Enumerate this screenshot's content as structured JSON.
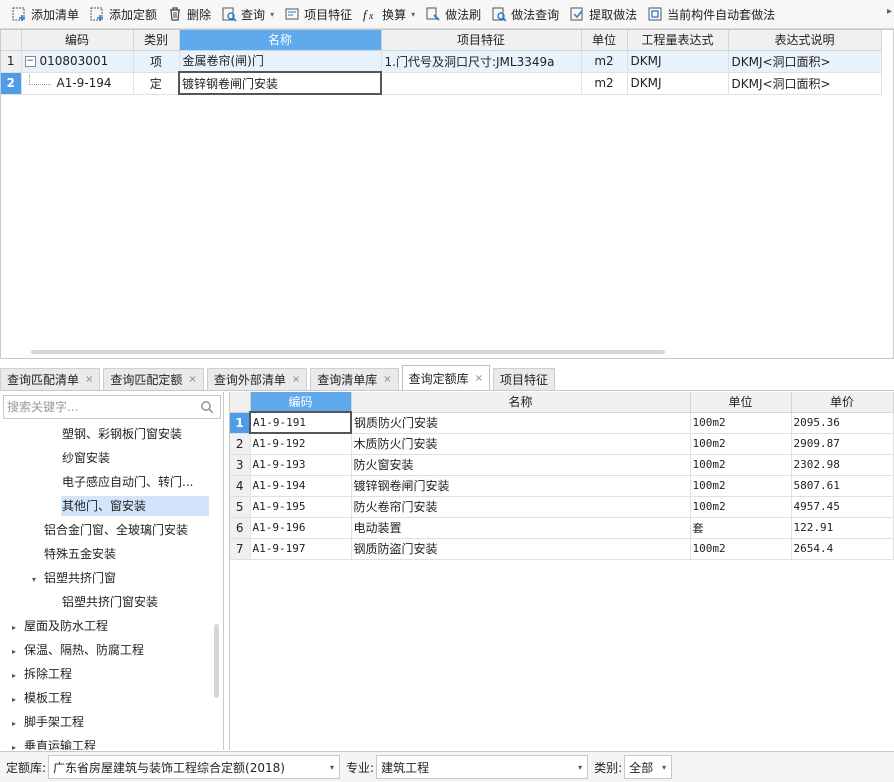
{
  "toolbar": {
    "items": [
      {
        "label": "添加清单",
        "icon": "add-list-icon",
        "dropdown": false
      },
      {
        "label": "添加定额",
        "icon": "add-quota-icon",
        "dropdown": false
      },
      {
        "label": "删除",
        "icon": "trash-icon",
        "dropdown": false
      },
      {
        "label": "查询",
        "icon": "query-icon",
        "dropdown": true
      },
      {
        "label": "项目特征",
        "icon": "feature-icon",
        "dropdown": false
      },
      {
        "label": "换算",
        "icon": "fx-icon",
        "dropdown": true
      },
      {
        "label": "做法刷",
        "icon": "brush-icon",
        "dropdown": false
      },
      {
        "label": "做法查询",
        "icon": "method-query-icon",
        "dropdown": false
      },
      {
        "label": "提取做法",
        "icon": "extract-icon",
        "dropdown": false
      },
      {
        "label": "当前构件自动套做法",
        "icon": "auto-apply-icon",
        "dropdown": false
      }
    ]
  },
  "upper_grid": {
    "headers": [
      "编码",
      "类别",
      "名称",
      "项目特征",
      "单位",
      "工程量表达式",
      "表达式说明"
    ],
    "rows": [
      {
        "row_no": "1",
        "toggle": "−",
        "code": "010803001",
        "type": "项",
        "name": "金属卷帘(闸)门",
        "feature": "1.门代号及洞口尺寸:JML3349a",
        "unit": "m2",
        "expr": "DKMJ",
        "expr_desc": "DKMJ<洞口面积>"
      },
      {
        "row_no": "2",
        "code": "A1-9-194",
        "type": "定",
        "name": "镀锌钢卷闸门安装",
        "feature": "",
        "unit": "m2",
        "expr": "DKMJ",
        "expr_desc": "DKMJ<洞口面积>"
      }
    ]
  },
  "tabs": [
    {
      "label": "查询匹配清单",
      "active": false
    },
    {
      "label": "查询匹配定额",
      "active": false
    },
    {
      "label": "查询外部清单",
      "active": false
    },
    {
      "label": "查询清单库",
      "active": false
    },
    {
      "label": "查询定额库",
      "active": true
    },
    {
      "label": "项目特征",
      "active": false
    }
  ],
  "tab_close": "×",
  "left_panel": {
    "search_placeholder": "搜索关键字...",
    "tree": [
      {
        "label": "塑钢、彩钢板门窗安装",
        "arrow": ""
      },
      {
        "label": "纱窗安装",
        "arrow": ""
      },
      {
        "label": "电子感应自动门、转门...",
        "arrow": ""
      },
      {
        "label": "其他门、窗安装",
        "arrow": ""
      },
      {
        "label": "铝合金门窗、全玻璃门安装",
        "arrow": ""
      },
      {
        "label": "特殊五金安装",
        "arrow": ""
      },
      {
        "label": "铝塑共挤门窗",
        "arrow": "▾"
      },
      {
        "label": "铝塑共挤门窗安装",
        "arrow": ""
      },
      {
        "label": "屋面及防水工程",
        "arrow": "▸"
      },
      {
        "label": "保温、隔热、防腐工程",
        "arrow": "▸"
      },
      {
        "label": "拆除工程",
        "arrow": "▸"
      },
      {
        "label": "模板工程",
        "arrow": "▸"
      },
      {
        "label": "脚手架工程",
        "arrow": "▸"
      },
      {
        "label": "垂直运输工程",
        "arrow": "▸"
      }
    ]
  },
  "lower_grid": {
    "headers": [
      "编码",
      "名称",
      "单位",
      "单价"
    ],
    "rows": [
      {
        "row_no": "1",
        "code": "A1-9-191",
        "name": "钢质防火门安装",
        "unit": "100m2",
        "price": "2095.36"
      },
      {
        "row_no": "2",
        "code": "A1-9-192",
        "name": "木质防火门安装",
        "unit": "100m2",
        "price": "2909.87"
      },
      {
        "row_no": "3",
        "code": "A1-9-193",
        "name": "防火窗安装",
        "unit": "100m2",
        "price": "2302.98"
      },
      {
        "row_no": "4",
        "code": "A1-9-194",
        "name": "镀锌钢卷闸门安装",
        "unit": "100m2",
        "price": "5807.61"
      },
      {
        "row_no": "5",
        "code": "A1-9-195",
        "name": "防火卷帘门安装",
        "unit": "100m2",
        "price": "4957.45"
      },
      {
        "row_no": "6",
        "code": "A1-9-196",
        "name": "电动装置",
        "unit": "套",
        "price": "122.91"
      },
      {
        "row_no": "7",
        "code": "A1-9-197",
        "name": "钢质防盗门安装",
        "unit": "100m2",
        "price": "2654.4"
      }
    ]
  },
  "bottom_bar": {
    "quota_label": "定额库:",
    "quota_value": "广东省房屋建筑与装饰工程综合定额(2018)",
    "major_label": "专业:",
    "major_value": "建筑工程",
    "category_label": "类别:",
    "category_value": "全部"
  },
  "colors": {
    "header_selected": "#5fa9ec",
    "row_selected_marker": "#4f9de8",
    "row_highlight": "#e8f2fd",
    "tree_selected": "#d2e5fb"
  }
}
